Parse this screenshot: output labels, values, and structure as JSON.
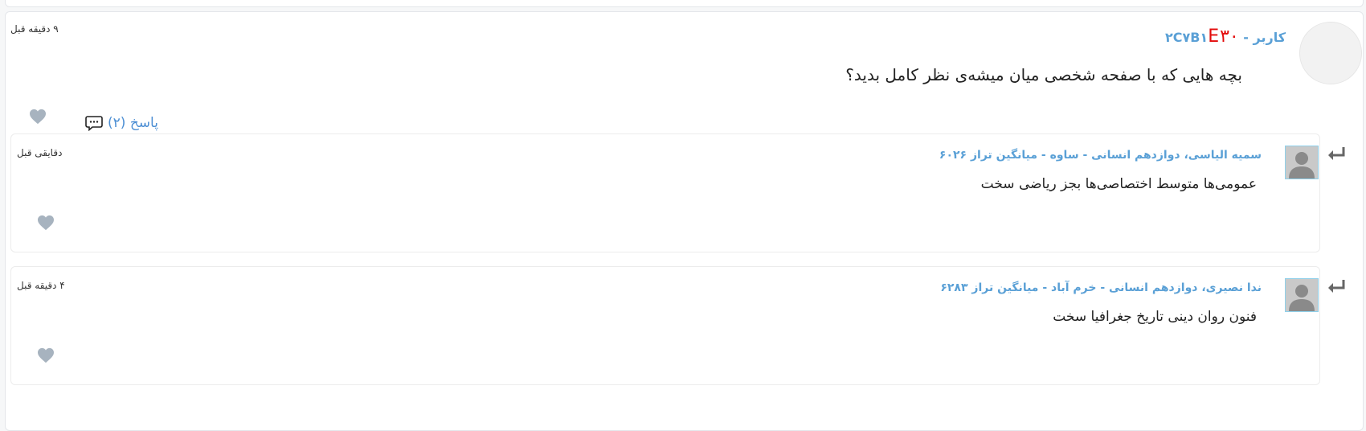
{
  "post": {
    "author_prefix": "کاربر - ",
    "author_code_red": "E۳۰",
    "author_code_blue": "۲C۷B۱",
    "time": "۹ دقیقه قبل",
    "text": "بچه هایی که با صفحه شخصی میان میشه‌ی نظر کامل بدید؟",
    "reply_label": "پاسخ (۲)"
  },
  "replies": [
    {
      "name": "سمیه الیاسی، دوازدهم انسانی - ساوه - میانگین تراز ۶۰۲۶",
      "time": "دقایقی قبل",
      "text": "عمومی‌ها متوسط اختصاصی‌ها بجز ریاضی سخت"
    },
    {
      "name": "ندا نصیری، دوازدهم انسانی - خرم آباد - میانگین تراز ۶۲۸۳",
      "time": "۴ دقیقه قبل",
      "text": "فنون روان دینی تاریخ جغرافیا سخت"
    }
  ],
  "icons": {
    "heart": "heart-icon",
    "comment": "comment-icon",
    "reply_arrow": "reply-arrow-icon",
    "avatar": "avatar-icon"
  },
  "colors": {
    "link": "#5aa0d6",
    "code_red": "#e30b0b",
    "heart": "#a7b3bf"
  }
}
